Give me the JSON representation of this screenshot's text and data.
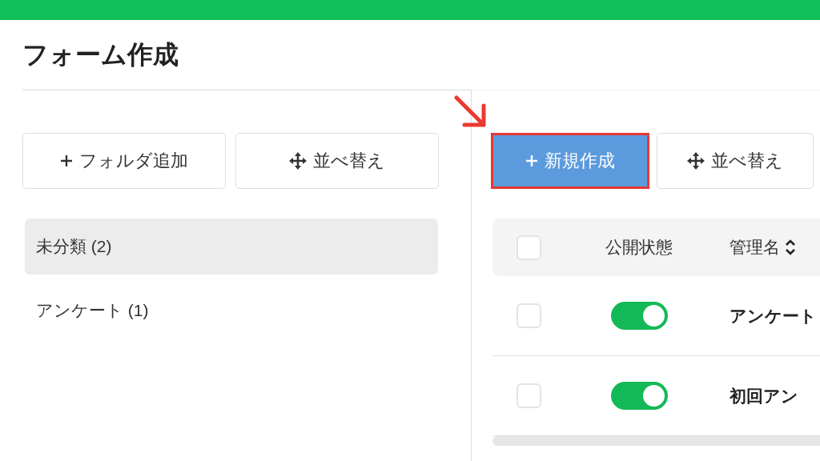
{
  "page": {
    "title": "フォーム作成"
  },
  "folder_panel": {
    "buttons": [
      {
        "label": "フォルダ追加",
        "kind": "add"
      },
      {
        "label": "並べ替え",
        "kind": "sort"
      }
    ],
    "folders": [
      {
        "label": "未分類 (2)",
        "selected": true
      },
      {
        "label": "アンケート (1)",
        "selected": false
      }
    ]
  },
  "form_panel": {
    "buttons": [
      {
        "label": "新規作成",
        "kind": "add",
        "primary": true,
        "highlighted": true
      },
      {
        "label": "並べ替え",
        "kind": "sort",
        "primary": false,
        "highlighted": false
      }
    ],
    "table": {
      "header_checkbox": {
        "checked": false
      },
      "columns": [
        {
          "label": "公開状態",
          "sortable": false
        },
        {
          "label": "管理名",
          "sortable": true
        }
      ],
      "rows": [
        {
          "checked": false,
          "published": true,
          "name": "アンケート"
        },
        {
          "checked": false,
          "published": true,
          "name": "初回アン"
        }
      ]
    }
  }
}
